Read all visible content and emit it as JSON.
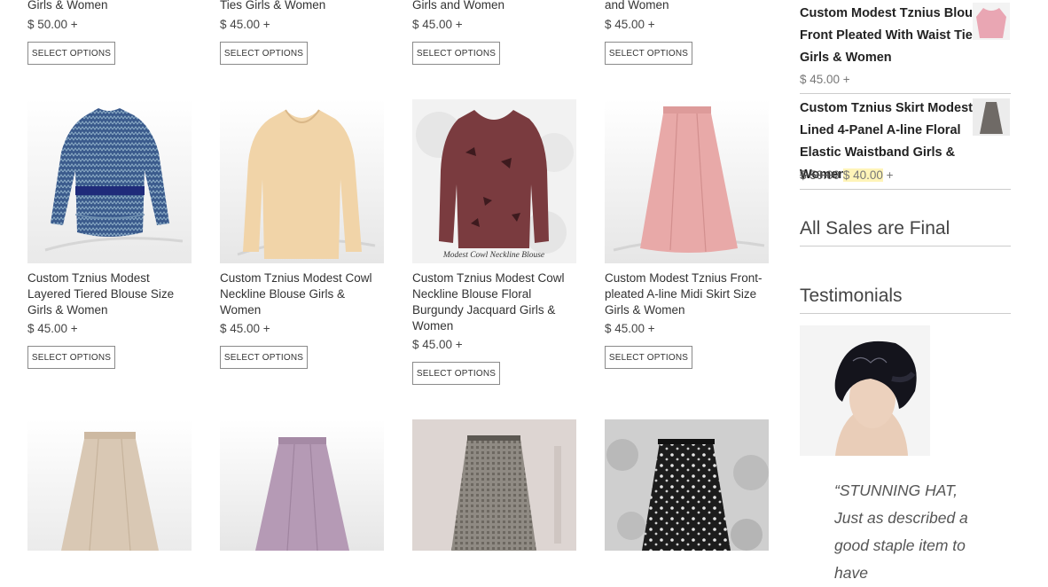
{
  "top_row": [
    {
      "title_tail": "Girls & Women",
      "price": "$ 50.00 +",
      "button": "SELECT OPTIONS"
    },
    {
      "title_tail": "Ties Girls & Women",
      "price": "$ 45.00 +",
      "button": "SELECT OPTIONS"
    },
    {
      "title_tail": "Girls and Women",
      "price": "$ 45.00 +",
      "button": "SELECT OPTIONS"
    },
    {
      "title_tail": "and Women",
      "price": "$ 45.00 +",
      "button": "SELECT OPTIONS"
    }
  ],
  "middle_row": [
    {
      "title": "Custom Tznius Modest Layered Tiered Blouse Size Girls & Women",
      "price": "$ 45.00 +",
      "button": "SELECT OPTIONS"
    },
    {
      "title": "Custom Tznius Modest Cowl Neckline Blouse Girls & Women",
      "price": "$ 45.00 +",
      "button": "SELECT OPTIONS"
    },
    {
      "title": "Custom Tznius Modest Cowl Neckline Blouse Floral Burgundy Jacquard Girls & Women",
      "price": "$ 45.00 +",
      "button": "SELECT OPTIONS",
      "image_caption": "Modest Cowl Neckline Blouse"
    },
    {
      "title": "Custom Modest Tznius Front-pleated A-line Midi Skirt Size Girls & Women",
      "price": "$ 45.00 +",
      "button": "SELECT OPTIONS"
    }
  ],
  "sidebar": {
    "products": [
      {
        "title": "Custom Modest Tznius Blouse Front Pleated With Waist Ties Girls & Women",
        "price": "$ 45.00 +"
      },
      {
        "title": "Custom Tznius Skirt Modest Lined 4-Panel A-line Floral Elastic Waistband Girls & Women",
        "old_price": "$ 50.00",
        "sale_price": "$ 40.00",
        "price_suffix": "+"
      }
    ],
    "sales_heading": "All Sales are Final",
    "testimonials_heading": "Testimonials",
    "quote": "“STUNNING HAT, Just as described a good staple item to have"
  },
  "colors": {
    "blouse_blue": "#3a5a8c",
    "blouse_peach": "#f1d4a8",
    "blouse_burgundy": "#7a3b3f",
    "skirt_pink": "#e8a9a8",
    "skirt_beige": "#d9c8b4",
    "skirt_lilac": "#b59ab5",
    "skirt_gray": "#8f8a83",
    "skirt_black": "#1c1c1c",
    "sale_highlight": "#fff4b8"
  }
}
